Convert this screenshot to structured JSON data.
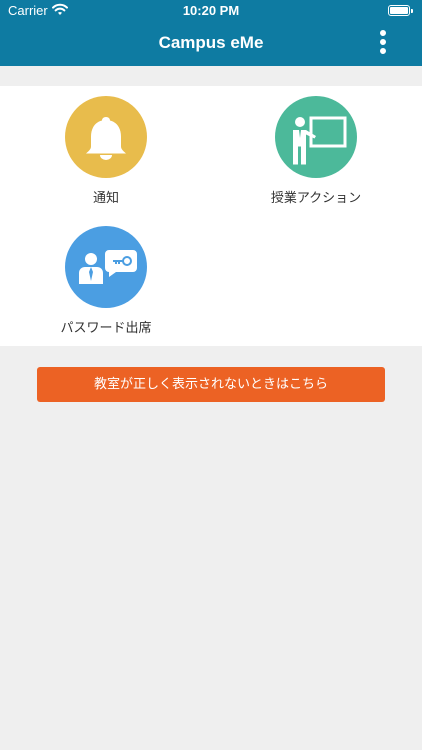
{
  "status_bar": {
    "carrier": "Carrier",
    "time": "10:20 PM"
  },
  "header": {
    "title": "Campus eMe",
    "menu_icon": "more-vertical-icon"
  },
  "menu": {
    "items": [
      {
        "label": "通知",
        "icon": "bell-icon",
        "color": "#e8bc4c"
      },
      {
        "label": "授業アクション",
        "icon": "teacher-whiteboard-icon",
        "color": "#4cb99a"
      },
      {
        "label": "パスワード出席",
        "icon": "user-key-icon",
        "color": "#4b9ee2"
      }
    ]
  },
  "help_button": {
    "label": "教室が正しく表示されないときはこちら",
    "color": "#ec6224"
  },
  "colors": {
    "header": "#0e7ba2",
    "background": "#efefef"
  }
}
